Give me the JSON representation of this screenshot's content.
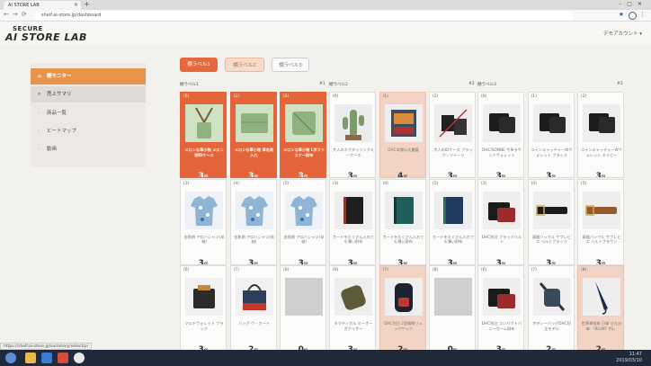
{
  "browser": {
    "tab_title": "AI STORE LAB",
    "url": "shelf.ai-store.jp/dashboard",
    "status_url": "https://shelf.ai-store.jp/summary/select/pi"
  },
  "header": {
    "logo_top": "SECURE",
    "logo_main": "AI STORE LAB",
    "account": "デモアカウント ▾"
  },
  "sidebar": {
    "items": [
      {
        "label": "棚モニター",
        "icon": "home-icon"
      },
      {
        "label": "売上サマリ",
        "icon": "search-icon"
      },
      {
        "label": "商品一覧",
        "icon": "bullet-icon"
      },
      {
        "label": "ヒートマップ",
        "icon": "bullet-icon"
      },
      {
        "label": "動画",
        "icon": "bullet-icon"
      }
    ]
  },
  "shelf_tabs": [
    "棚ラベル1",
    "棚ラベル2",
    "棚ラベル3"
  ],
  "shelves": [
    {
      "title": "棚ラベル1",
      "num": "#1",
      "cells": [
        {
          "idx": "(0)",
          "name": "メロンな革小物 メロン柄IDケース",
          "count": "3",
          "hl": "strong",
          "thumb": "lanyard"
        },
        {
          "idx": "(1)",
          "name": "メロンな革小物 革名刺入れ",
          "count": "3",
          "hl": "strong",
          "thumb": "card"
        },
        {
          "idx": "(2)",
          "name": "メロンな革小物 L字ファスナー財布",
          "count": "3",
          "hl": "strong",
          "thumb": "wallet"
        },
        {
          "idx": "(3)",
          "name": "金魚柄 アロハシャツ(半袖)",
          "count": "3",
          "hl": "",
          "thumb": "shirt"
        },
        {
          "idx": "(4)",
          "name": "金魚柄 アロハシャツ(長袖)",
          "count": "3",
          "hl": "",
          "thumb": "shirt"
        },
        {
          "idx": "(5)",
          "name": "金魚柄 アロハシャツ(半袖)",
          "count": "3",
          "hl": "",
          "thumb": "shirt"
        },
        {
          "idx": "(6)",
          "name": "マルチウォレット ブラック",
          "count": "3",
          "hl": "",
          "thumb": "bag"
        },
        {
          "idx": "(7)",
          "name": "バッグ ウ・カート",
          "count": "2",
          "hl": "",
          "thumb": "tote"
        },
        {
          "idx": "(8)",
          "name": "",
          "count": "0",
          "hl": "",
          "thumb": "empty"
        }
      ]
    },
    {
      "title": "棚ラベル2",
      "num": "#2",
      "cells": [
        {
          "idx": "(0)",
          "name": "大人のネクタイリングキーケース",
          "count": "3",
          "hl": "",
          "thumb": "cactus"
        },
        {
          "idx": "(1)",
          "name": "DHC本舗公式書籍",
          "count": "4",
          "hl": "light",
          "thumb": "book"
        },
        {
          "idx": "(2)",
          "name": "大人のIDケース ブラック・ツイード",
          "count": "3",
          "hl": "",
          "thumb": "pens"
        },
        {
          "idx": "(3)",
          "name": "カードをたくさん入れても薄い財布",
          "count": "3",
          "hl": "",
          "thumb": "notebook-black"
        },
        {
          "idx": "(4)",
          "name": "カードをたくさん入れても薄い財布",
          "count": "3",
          "hl": "",
          "thumb": "notebook-teal"
        },
        {
          "idx": "(5)",
          "name": "カードをたくさん入れても薄い財布",
          "count": "3",
          "hl": "",
          "thumb": "notebook-navy"
        },
        {
          "idx": "(6)",
          "name": "タクティカル キーオーガナイザー",
          "count": "3",
          "hl": "",
          "thumb": "pouch"
        },
        {
          "idx": "(7)",
          "name": "DHC別注 2室開閉リュックサック",
          "count": "2",
          "hl": "light",
          "thumb": "backpack"
        },
        {
          "idx": "(8)",
          "name": "",
          "count": "0",
          "hl": "",
          "thumb": "empty"
        }
      ]
    },
    {
      "title": "棚ラベル3",
      "num": "#3",
      "cells": [
        {
          "idx": "(0)",
          "name": "DHC/SONNE 牛革ラウンドウォレット",
          "count": "3",
          "hl": "",
          "thumb": "wallet-black"
        },
        {
          "idx": "(1)",
          "name": "コインキャッチャーWウォレット ブラック",
          "count": "3",
          "hl": "",
          "thumb": "wallet-black"
        },
        {
          "idx": "(2)",
          "name": "コインキャッチャーWウォレット ネイビー",
          "count": "3",
          "hl": "",
          "thumb": "wallet-black"
        },
        {
          "idx": "(3)",
          "name": "DHC別注 ブラックベルト",
          "count": "3",
          "hl": "",
          "thumb": "wallet-red"
        },
        {
          "idx": "(4)",
          "name": "真鍮バックル サブレビエ ベルトブラック",
          "count": "3",
          "hl": "",
          "thumb": "belt"
        },
        {
          "idx": "(5)",
          "name": "真鍮バックル サブレビエ ベルトブラウン",
          "count": "3",
          "hl": "",
          "thumb": "belt-brown"
        },
        {
          "idx": "(6)",
          "name": "DHC別注 コンパクトバニーカーム財布",
          "count": "3",
          "hl": "",
          "thumb": "wallet-red"
        },
        {
          "idx": "(7)",
          "name": "ボディーバッグDHC別注モデル",
          "count": "2",
          "hl": "",
          "thumb": "bodybag"
        },
        {
          "idx": "(8)",
          "name": "世界最強傘 日傘 ひ九分傘 「BLUNT XS」",
          "count": "2",
          "hl": "light",
          "thumb": "umbrella"
        }
      ]
    }
  ],
  "count_unit": "個",
  "taskbar": {
    "time": "11:47",
    "date": "2019/03/10"
  }
}
